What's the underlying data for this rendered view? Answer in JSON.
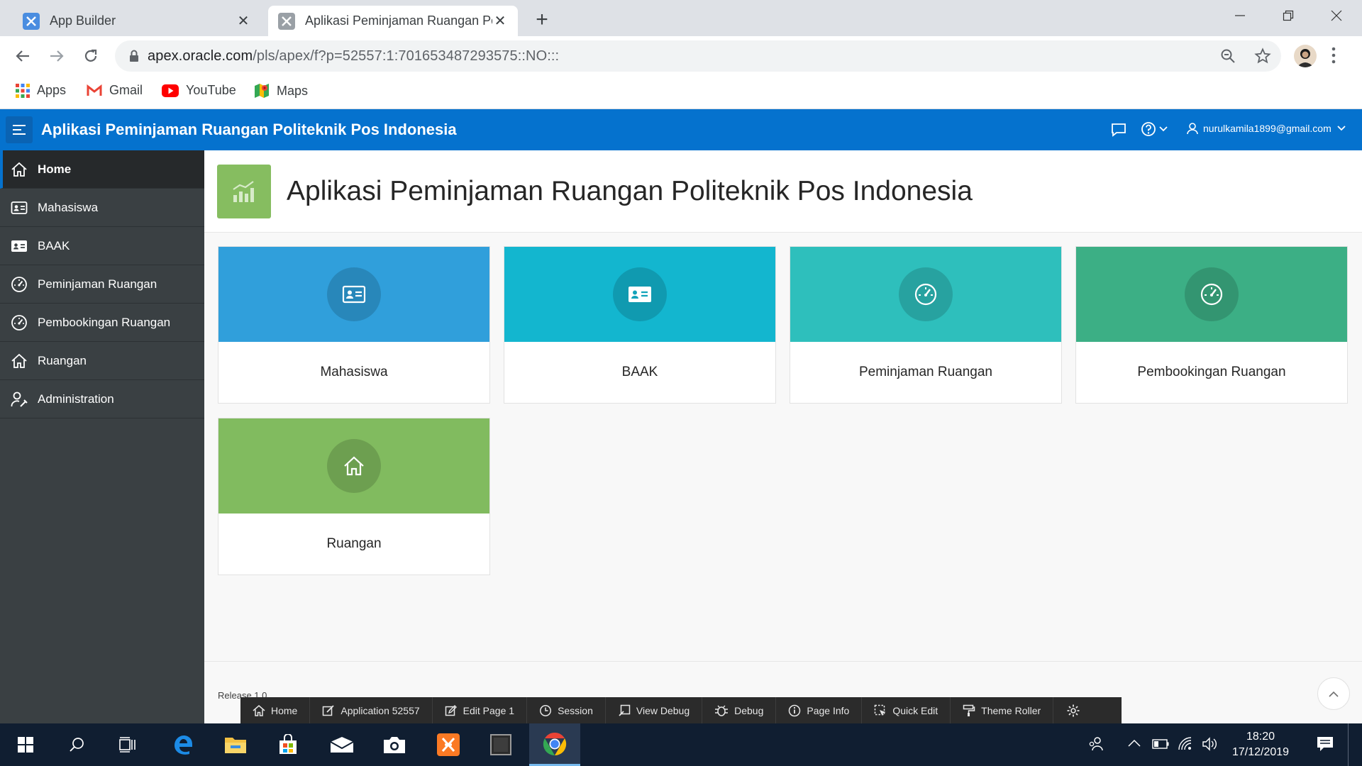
{
  "browser": {
    "tabs": [
      {
        "title": "App Builder"
      },
      {
        "title": "Aplikasi Peminjaman Ruangan Po"
      }
    ],
    "url_host": "apex.oracle.com",
    "url_path": "/pls/apex/f?p=52557:1:701653487293575::NO:::",
    "bookmarks": [
      {
        "label": "Apps"
      },
      {
        "label": "Gmail"
      },
      {
        "label": "YouTube"
      },
      {
        "label": "Maps"
      }
    ]
  },
  "header": {
    "title": "Aplikasi Peminjaman Ruangan Politeknik Pos Indonesia",
    "user": "nurulkamila1899@gmail.com"
  },
  "sidebar": {
    "items": [
      {
        "label": "Home",
        "icon": "home-icon",
        "active": true
      },
      {
        "label": "Mahasiswa",
        "icon": "id-card-icon"
      },
      {
        "label": "BAAK",
        "icon": "id-card-filled-icon"
      },
      {
        "label": "Peminjaman Ruangan",
        "icon": "gauge-icon"
      },
      {
        "label": "Pembookingan Ruangan",
        "icon": "gauge-icon"
      },
      {
        "label": "Ruangan",
        "icon": "home-icon"
      },
      {
        "label": "Administration",
        "icon": "user-wrench-icon"
      }
    ]
  },
  "page": {
    "title": "Aplikasi Peminjaman Ruangan Politeknik Pos Indonesia",
    "cards": [
      {
        "label": "Mahasiswa",
        "color": "#309fdb",
        "icon": "id-card-icon"
      },
      {
        "label": "BAAK",
        "color": "#13b6cf",
        "icon": "id-card-filled-icon"
      },
      {
        "label": "Peminjaman Ruangan",
        "color": "#2ebfbc",
        "icon": "gauge-icon"
      },
      {
        "label": "Pembookingan Ruangan",
        "color": "#3caf85",
        "icon": "gauge-icon"
      },
      {
        "label": "Ruangan",
        "color": "#81bb5f",
        "icon": "home-icon"
      }
    ],
    "footer": {
      "release": "Release 1.0"
    }
  },
  "devbar": {
    "items": [
      {
        "label": "Home",
        "icon": "home-icon"
      },
      {
        "label": "Application 52557",
        "icon": "edit-app-icon"
      },
      {
        "label": "Edit Page 1",
        "icon": "edit-page-icon"
      },
      {
        "label": "Session",
        "icon": "session-icon"
      },
      {
        "label": "View Debug",
        "icon": "view-debug-icon"
      },
      {
        "label": "Debug",
        "icon": "bug-icon"
      },
      {
        "label": "Page Info",
        "icon": "info-icon"
      },
      {
        "label": "Quick Edit",
        "icon": "quick-edit-icon"
      },
      {
        "label": "Theme Roller",
        "icon": "paint-roller-icon"
      }
    ]
  },
  "taskbar": {
    "time": "18:20",
    "date": "17/12/2019"
  },
  "colors": {
    "accent": "#0572ce",
    "sidebar": "#3a4043",
    "hero_icon": "#86bd60"
  }
}
